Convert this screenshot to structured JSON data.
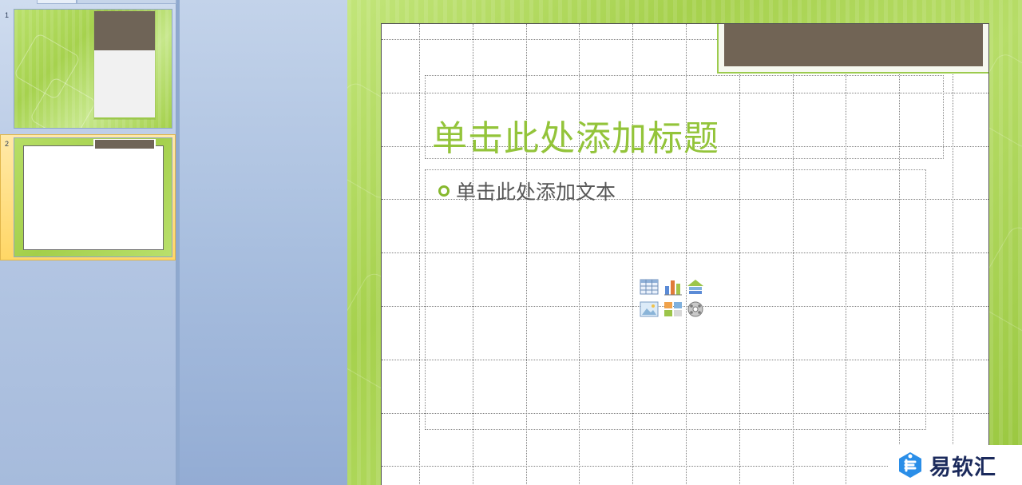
{
  "thumbnails": [
    {
      "number": "1"
    },
    {
      "number": "2"
    }
  ],
  "slide": {
    "title_placeholder": "单击此处添加标题",
    "body_placeholder": "单击此处添加文本"
  },
  "content_icons": [
    "table-icon",
    "chart-icon",
    "smartart-icon",
    "picture-icon",
    "clipart-icon",
    "media-icon"
  ],
  "watermark": {
    "text": "易软汇"
  },
  "colors": {
    "theme_green": "#a6d14d",
    "accent_brown": "#716455",
    "title_green": "#93c43a",
    "selection_yellow": "#ffd766"
  }
}
